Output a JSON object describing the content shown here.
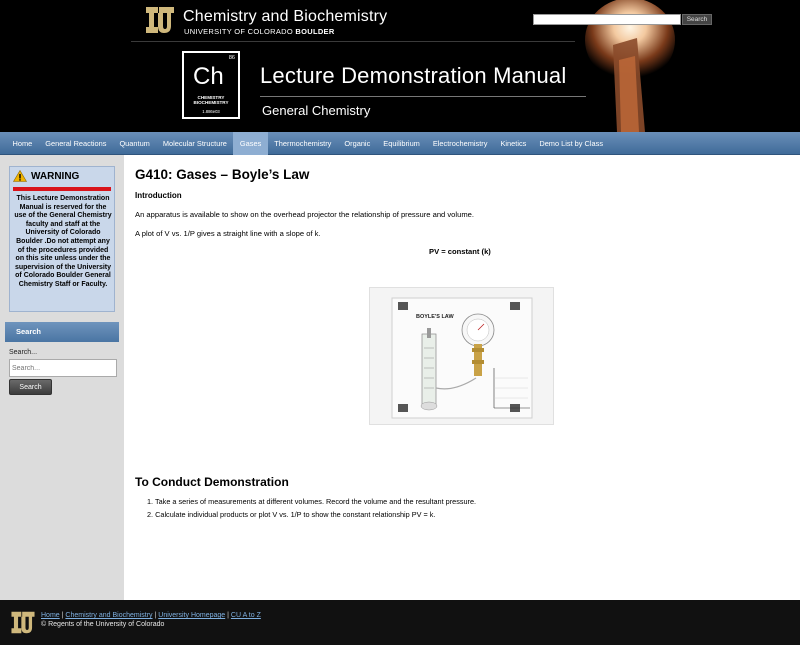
{
  "header": {
    "dept_name": "Chemistry and Biochemistry",
    "university": "UNIVERSITY OF COLORADO",
    "university_bold": "BOULDER",
    "search_button": "Search",
    "element_number": "86",
    "element_symbol": "Ch",
    "element_name_line1": "CHEMISTRY",
    "element_name_line2": "BIOCHEMISTRY",
    "element_mass": "1.886e03",
    "manual_title": "Lecture Demonstration Manual",
    "manual_subtitle": "General Chemistry"
  },
  "nav": {
    "items": [
      "Home",
      "General Reactions",
      "Quantum",
      "Molecular Structure",
      "Gases",
      "Thermochemistry",
      "Organic",
      "Equilibrium",
      "Electrochemistry",
      "Kinetics",
      "Demo List by Class"
    ],
    "active": "Gases"
  },
  "sidebar": {
    "warning_title": "WARNING",
    "warning_text": "This Lecture Demonstration Manual is reserved for the use of the General Chemistry faculty and staff at the University of Colorado Boulder .Do not attempt any of the procedures provided on this site unless under the supervision of the University of Colorado Boulder General Chemistry Staff or Faculty.",
    "search_heading": "Search",
    "search_label": "Search...",
    "search_placeholder": "Search...",
    "search_button": "Search"
  },
  "content": {
    "title": "G410: Gases – Boyle’s Law",
    "intro_heading": "Introduction",
    "para1": "An apparatus is available to show on the overhead projector the relationship of pressure and volume.",
    "para2": "A plot of V vs. 1/P gives a straight line with a slope of k.",
    "formula": "PV = constant (k)",
    "photo_label": "BOYLE'S LAW",
    "conduct_heading": "To Conduct Demonstration",
    "steps": [
      "1.  Take a series of measurements at different volumes.  Record the volume and the resultant pressure.",
      "2.  Calculate individual products or plot V vs. 1/P to show the constant relationship PV = k."
    ]
  },
  "footer": {
    "links": [
      "Home",
      "Chemistry and Biochemistry",
      "University Homepage",
      "CU A to Z"
    ],
    "copyright": "© Regents of the University of Colorado"
  },
  "colors": {
    "nav_blue": "#4f7aa8",
    "warning_red": "#d9141b",
    "warning_bg": "#c9d7ea",
    "cu_gold": "#cfb87c"
  }
}
